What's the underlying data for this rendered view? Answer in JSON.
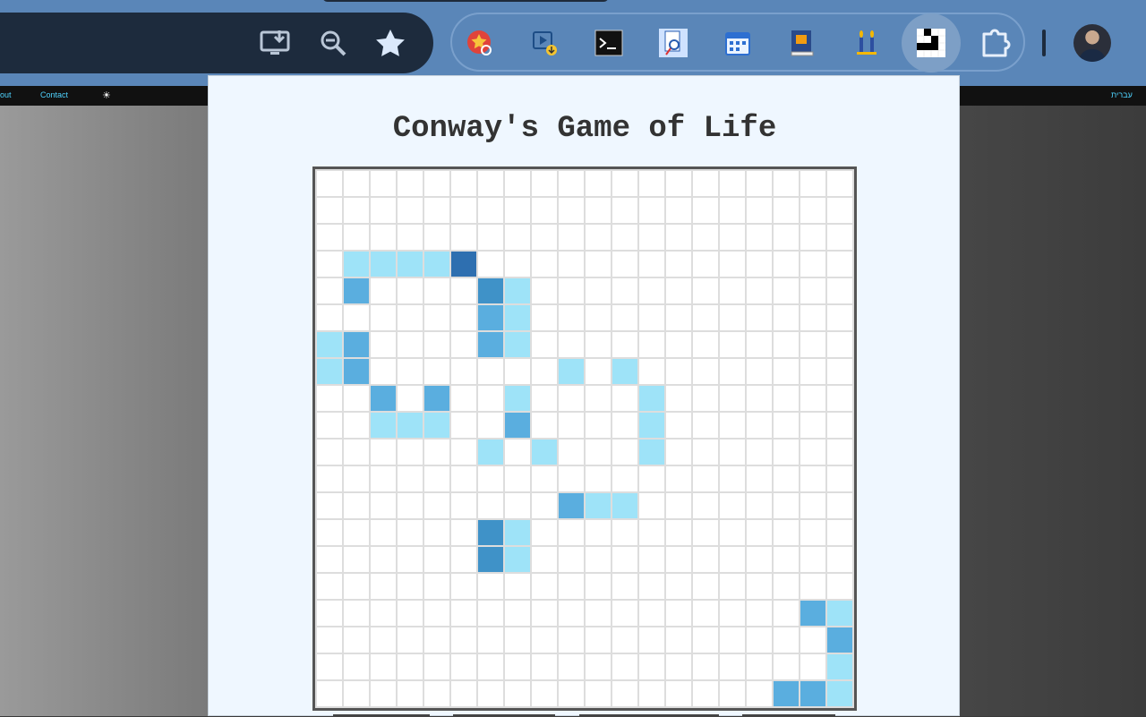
{
  "toolbar": {
    "icons": [
      "install-app-icon",
      "zoom-icon",
      "bookmark-star-icon"
    ]
  },
  "extensions": [
    {
      "name": "extension-star-search-icon"
    },
    {
      "name": "extension-video-download-icon"
    },
    {
      "name": "extension-terminal-icon"
    },
    {
      "name": "extension-document-search-icon"
    },
    {
      "name": "extension-calendar-icon"
    },
    {
      "name": "extension-book-icon"
    },
    {
      "name": "extension-candles-icon"
    },
    {
      "name": "extension-game-of-life-icon"
    },
    {
      "name": "extensions-puzzle-icon"
    }
  ],
  "site_nav": {
    "about": "out",
    "contact": "Contact",
    "theme_icon": "sun-icon",
    "language": "עברית"
  },
  "popup": {
    "title": "Conway's Game of Life",
    "grid": {
      "rows": 20,
      "cols": 20,
      "colors": {
        "1": "#9ee3f8",
        "2": "#5aaedf",
        "3": "#3f92c8",
        "4": "#2e6fb0"
      },
      "cells": [
        [
          0,
          0,
          0,
          0,
          0,
          0,
          0,
          0,
          0,
          0,
          0,
          0,
          0,
          0,
          0,
          0,
          0,
          0,
          0,
          0
        ],
        [
          0,
          0,
          0,
          0,
          0,
          0,
          0,
          0,
          0,
          0,
          0,
          0,
          0,
          0,
          0,
          0,
          0,
          0,
          0,
          0
        ],
        [
          0,
          0,
          0,
          0,
          0,
          0,
          0,
          0,
          0,
          0,
          0,
          0,
          0,
          0,
          0,
          0,
          0,
          0,
          0,
          0
        ],
        [
          0,
          1,
          1,
          1,
          1,
          4,
          0,
          0,
          0,
          0,
          0,
          0,
          0,
          0,
          0,
          0,
          0,
          0,
          0,
          0
        ],
        [
          0,
          2,
          0,
          0,
          0,
          0,
          3,
          1,
          0,
          0,
          0,
          0,
          0,
          0,
          0,
          0,
          0,
          0,
          0,
          0
        ],
        [
          0,
          0,
          0,
          0,
          0,
          0,
          2,
          1,
          0,
          0,
          0,
          0,
          0,
          0,
          0,
          0,
          0,
          0,
          0,
          0
        ],
        [
          1,
          2,
          0,
          0,
          0,
          0,
          2,
          1,
          0,
          0,
          0,
          0,
          0,
          0,
          0,
          0,
          0,
          0,
          0,
          0
        ],
        [
          1,
          2,
          0,
          0,
          0,
          0,
          0,
          0,
          0,
          1,
          0,
          1,
          0,
          0,
          0,
          0,
          0,
          0,
          0,
          0
        ],
        [
          0,
          0,
          2,
          0,
          2,
          0,
          0,
          1,
          0,
          0,
          0,
          0,
          1,
          0,
          0,
          0,
          0,
          0,
          0,
          0
        ],
        [
          0,
          0,
          1,
          1,
          1,
          0,
          0,
          2,
          0,
          0,
          0,
          0,
          1,
          0,
          0,
          0,
          0,
          0,
          0,
          0
        ],
        [
          0,
          0,
          0,
          0,
          0,
          0,
          1,
          0,
          1,
          0,
          0,
          0,
          1,
          0,
          0,
          0,
          0,
          0,
          0,
          0
        ],
        [
          0,
          0,
          0,
          0,
          0,
          0,
          0,
          0,
          0,
          0,
          0,
          0,
          0,
          0,
          0,
          0,
          0,
          0,
          0,
          0
        ],
        [
          0,
          0,
          0,
          0,
          0,
          0,
          0,
          0,
          0,
          2,
          1,
          1,
          0,
          0,
          0,
          0,
          0,
          0,
          0,
          0
        ],
        [
          0,
          0,
          0,
          0,
          0,
          0,
          3,
          1,
          0,
          0,
          0,
          0,
          0,
          0,
          0,
          0,
          0,
          0,
          0,
          0
        ],
        [
          0,
          0,
          0,
          0,
          0,
          0,
          3,
          1,
          0,
          0,
          0,
          0,
          0,
          0,
          0,
          0,
          0,
          0,
          0,
          0
        ],
        [
          0,
          0,
          0,
          0,
          0,
          0,
          0,
          0,
          0,
          0,
          0,
          0,
          0,
          0,
          0,
          0,
          0,
          0,
          0,
          0
        ],
        [
          0,
          0,
          0,
          0,
          0,
          0,
          0,
          0,
          0,
          0,
          0,
          0,
          0,
          0,
          0,
          0,
          0,
          0,
          2,
          1
        ],
        [
          0,
          0,
          0,
          0,
          0,
          0,
          0,
          0,
          0,
          0,
          0,
          0,
          0,
          0,
          0,
          0,
          0,
          0,
          0,
          2
        ],
        [
          0,
          0,
          0,
          0,
          0,
          0,
          0,
          0,
          0,
          0,
          0,
          0,
          0,
          0,
          0,
          0,
          0,
          0,
          0,
          1
        ],
        [
          0,
          0,
          0,
          0,
          0,
          0,
          0,
          0,
          0,
          0,
          0,
          0,
          0,
          0,
          0,
          0,
          0,
          2,
          2,
          1
        ]
      ]
    }
  }
}
